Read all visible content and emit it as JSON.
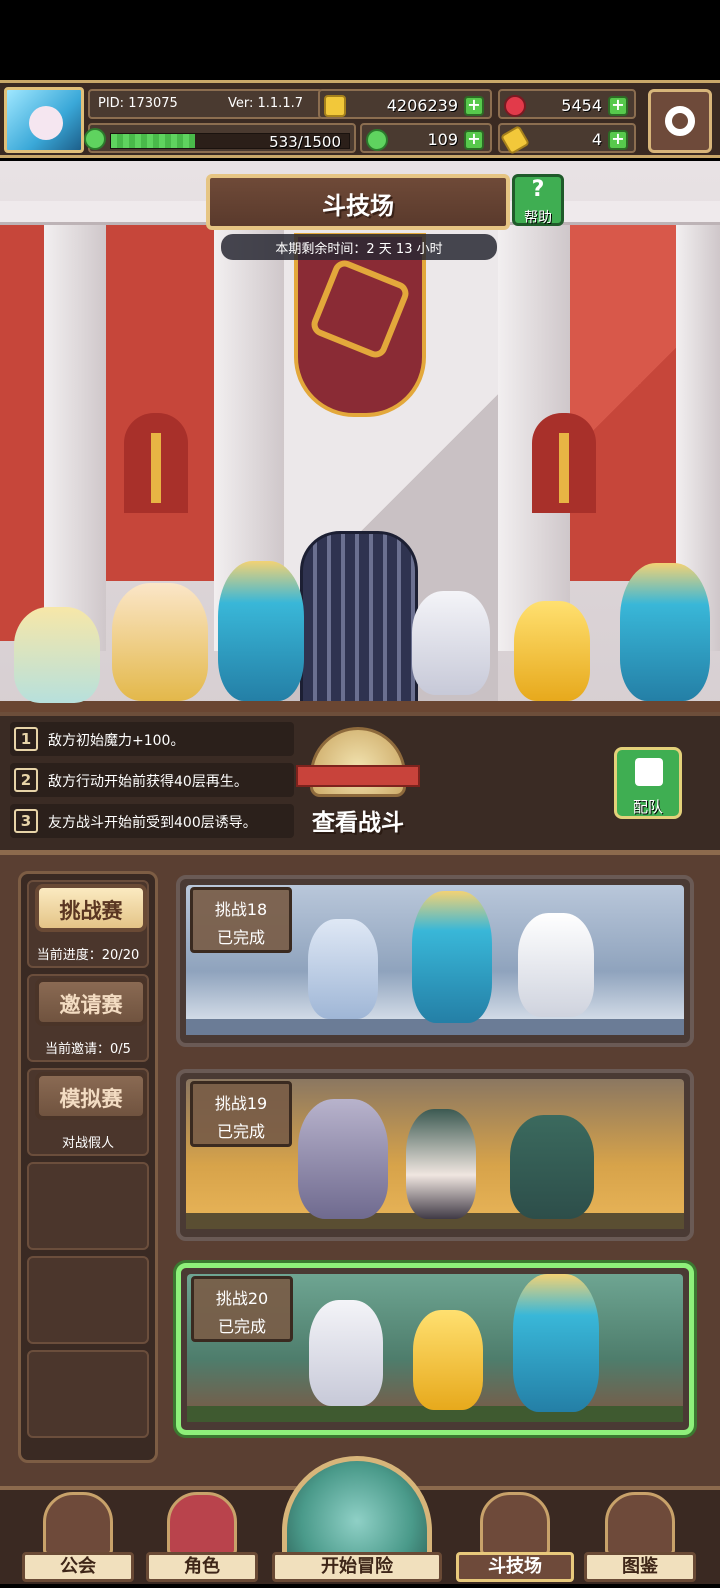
{
  "hud": {
    "pid": "PID: 173075",
    "version": "Ver: 1.1.1.7",
    "exp_text": "533/1500",
    "exp_fraction": 0.355,
    "resources": {
      "gold": "4206239",
      "gem": "5454",
      "clover": "109",
      "key": "4"
    },
    "colors": {
      "gold": "#f2c83a",
      "gem": "#e23a4a",
      "clover": "#5fd35f",
      "key": "#f2c83a"
    }
  },
  "arena": {
    "title": "斗技场",
    "help_label": "帮助",
    "help_icon": "?",
    "timer": "本期剩余时间：2 天 13 小时"
  },
  "rules": [
    {
      "num": "1",
      "text": "敌方初始魔力+100。"
    },
    {
      "num": "2",
      "text": "敌方行动开始前获得40层再生。"
    },
    {
      "num": "3",
      "text": "友方战斗开始前受到400层诱导。"
    }
  ],
  "view_battle": "查看战斗",
  "team_label": "配队",
  "modes": [
    {
      "label": "挑战赛",
      "note": "当前进度：20/20",
      "active": true
    },
    {
      "label": "邀请赛",
      "note": "当前邀请：0/5",
      "active": false
    },
    {
      "label": "模拟赛",
      "note": "对战假人",
      "active": false
    }
  ],
  "challenges": [
    {
      "name": "挑战18",
      "status": "已完成",
      "scene": "snow"
    },
    {
      "name": "挑战19",
      "status": "已完成",
      "scene": "autumn"
    },
    {
      "name": "挑战20",
      "status": "已完成",
      "scene": "forest"
    }
  ],
  "nav": {
    "guild": "公会",
    "character": "角色",
    "adventure": "开始冒险",
    "arena": "斗技场",
    "codex": "图鉴"
  }
}
